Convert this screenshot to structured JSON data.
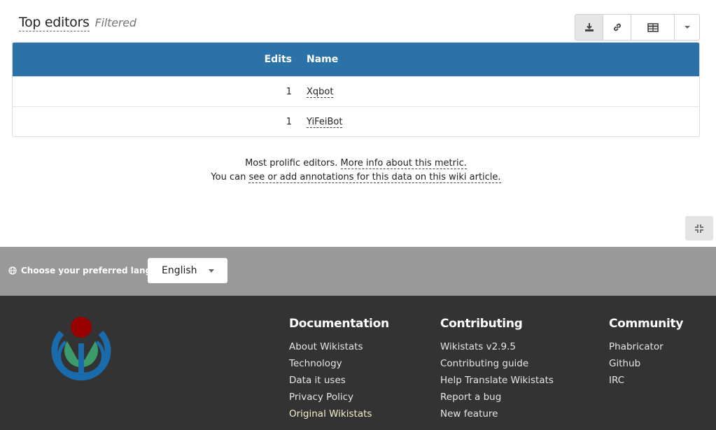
{
  "widget": {
    "title": "Top editors",
    "filter_label": "Filtered",
    "toolbar": {
      "download_icon": "download-icon",
      "link_icon": "link-icon",
      "table_icon": "table-icon",
      "caret_icon": "chevron-down-icon"
    },
    "table": {
      "headers": [
        "Edits",
        "Name"
      ],
      "rows": [
        {
          "edits": "1",
          "name": "Xqbot"
        },
        {
          "edits": "1",
          "name": "YiFeiBot"
        }
      ]
    },
    "caption": {
      "line1_prefix": "Most prolific editors.",
      "line1_link": "More info about this metric.",
      "line2_prefix": "You can",
      "line2_link": "see or add annotations for this data on this wiki article."
    }
  },
  "language": {
    "label": "Choose your preferred language",
    "selected": "English",
    "icon": "globe-icon"
  },
  "footer": {
    "columns": [
      {
        "title": "Documentation",
        "links": [
          "About Wikistats",
          "Technology",
          "Data it uses",
          "Privacy Policy",
          "Original Wikistats"
        ]
      },
      {
        "title": "Contributing",
        "links": [
          "Wikistats v2.9.5",
          "Contributing guide",
          "Help Translate Wikistats",
          "Report a bug",
          "New feature"
        ]
      },
      {
        "title": "Community",
        "links": [
          "Phabricator",
          "Github",
          "IRC"
        ]
      }
    ]
  },
  "colors": {
    "table_header": "#2a72a8",
    "lang_bar": "#999999",
    "footer_bg": "#333333",
    "logo_blue": "#1a6bab",
    "logo_green": "#3c9b6a",
    "logo_red": "#990000"
  }
}
